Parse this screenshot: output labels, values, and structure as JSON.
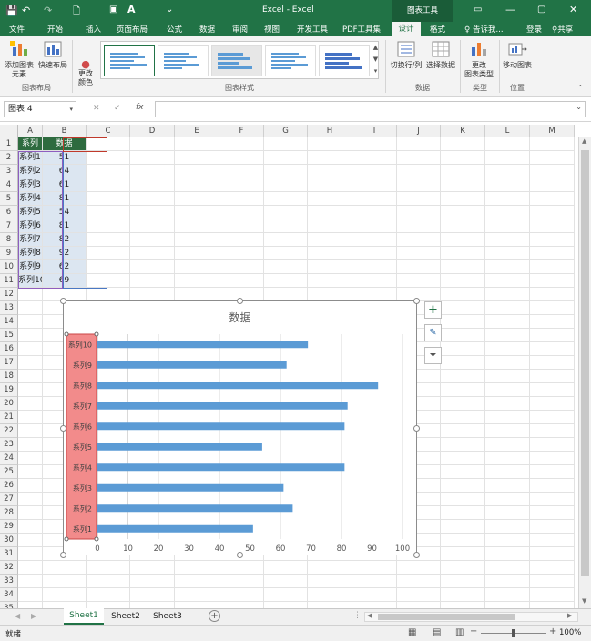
{
  "title_bar": {
    "title": "Excel - Excel",
    "context_tab": "图表工具"
  },
  "ribbon_tabs": [
    "文件",
    "开始",
    "插入",
    "页面布局",
    "公式",
    "数据",
    "审阅",
    "视图",
    "开发工具",
    "PDF工具集",
    "设计",
    "格式"
  ],
  "ribbon_extras": {
    "tell_me": "告诉我...",
    "login": "登录",
    "share": "共享"
  },
  "ribbon": {
    "add_element": "添加图表\n元素",
    "quick_layout": "快速布局",
    "change_color": "更改\n颜色",
    "group_layout": "图表布局",
    "group_styles": "图表样式",
    "switch_row_col": "切换行/列",
    "select_data": "选择数据",
    "group_data": "数据",
    "change_type": "更改\n图表类型",
    "group_type": "类型",
    "move_chart": "移动图表",
    "group_location": "位置"
  },
  "formula_bar": {
    "name_box": "图表 4",
    "cancel": "✕",
    "confirm": "✓",
    "fx": "fx",
    "value": ""
  },
  "columns": [
    "A",
    "B",
    "C",
    "D",
    "E",
    "F",
    "G",
    "H",
    "I",
    "J",
    "K",
    "L",
    "M"
  ],
  "rows": [
    "1",
    "2",
    "3",
    "4",
    "5",
    "6",
    "7",
    "8",
    "9",
    "10",
    "11",
    "12",
    "13",
    "14",
    "15",
    "16",
    "17",
    "18",
    "19",
    "20",
    "21",
    "22",
    "23",
    "24",
    "25",
    "26",
    "27",
    "28",
    "29",
    "30",
    "31",
    "32",
    "33",
    "34",
    "35"
  ],
  "table": {
    "headers": [
      "系列",
      "数据"
    ],
    "rows": [
      [
        "系列1",
        "51"
      ],
      [
        "系列2",
        "64"
      ],
      [
        "系列3",
        "61"
      ],
      [
        "系列4",
        "81"
      ],
      [
        "系列5",
        "54"
      ],
      [
        "系列6",
        "81"
      ],
      [
        "系列7",
        "82"
      ],
      [
        "系列8",
        "92"
      ],
      [
        "系列9",
        "62"
      ],
      [
        "系列10",
        "69"
      ]
    ]
  },
  "chart_data": {
    "type": "bar",
    "title": "数据",
    "categories": [
      "系列1",
      "系列2",
      "系列3",
      "系列4",
      "系列5",
      "系列6",
      "系列7",
      "系列8",
      "系列9",
      "系列10"
    ],
    "values": [
      51,
      64,
      61,
      81,
      54,
      81,
      82,
      92,
      62,
      69
    ],
    "xlim": [
      0,
      100
    ],
    "ticks": [
      "0",
      "10",
      "20",
      "30",
      "40",
      "50",
      "60",
      "70",
      "80",
      "90",
      "100"
    ],
    "grid": true,
    "bar_color": "#5b9bd5"
  },
  "sheets": [
    "Sheet1",
    "Sheet2",
    "Sheet3"
  ],
  "active_sheet": "Sheet1",
  "status": {
    "ready": "就绪",
    "zoom": "100%"
  },
  "colors": {
    "brand": "#217346",
    "header_fill": "#2e6b3f",
    "table_fill": "#dce6f1",
    "category_highlight": "#f28b8b"
  }
}
